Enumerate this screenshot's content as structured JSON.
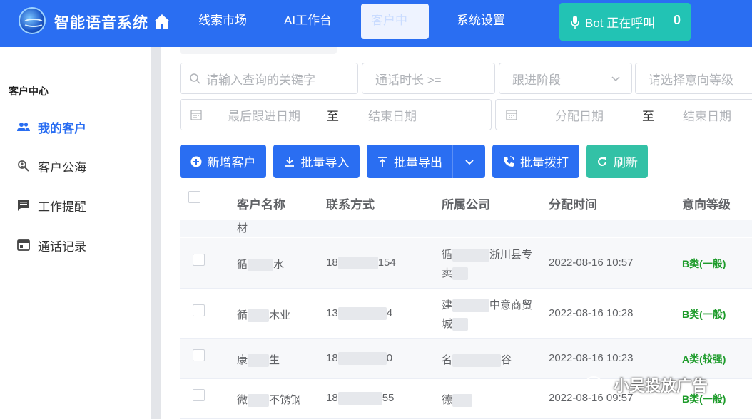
{
  "header": {
    "app_title": "智能语音系统",
    "nav": [
      "线索市场",
      "AI工作台",
      "客户中心",
      "系统设置"
    ],
    "active_nav": "客户中心",
    "bot_label": "Bot 正在呼叫",
    "bot_count": "0"
  },
  "sidebar": {
    "section": "客户中心",
    "items": [
      "我的客户",
      "客户公海",
      "工作提醒",
      "通话记录"
    ],
    "active": "我的客户"
  },
  "filters": {
    "keyword_placeholder": "请输入查询的关键字",
    "duration_placeholder": "通话时长 >=",
    "stage_placeholder": "跟进阶段",
    "intent_placeholder": "请选择意向等级",
    "last_follow_placeholder": "最后跟进日期",
    "to_label": "至",
    "end_date_placeholder": "结束日期",
    "assign_date_placeholder": "分配日期",
    "to_label_2": "至",
    "end_date_placeholder_2": "结束日期"
  },
  "toolbar": {
    "add_label": "新增客户",
    "import_label": "批量导入",
    "export_label": "批量导出",
    "dial_label": "批量拨打",
    "refresh_label": "刷新"
  },
  "table": {
    "headers": [
      "客户名称",
      "联系方式",
      "所属公司",
      "分配时间",
      "意向等级"
    ],
    "partial_top": "材",
    "rows": [
      {
        "name_a": "循",
        "name_b": "水",
        "phone_a": "18",
        "phone_b": "154",
        "company_l1a": "循",
        "company_l1b": "浙川县专",
        "company_l2": "卖",
        "time": "2022-08-16 10:57",
        "level": "B类(一般)"
      },
      {
        "name_a": "循",
        "name_b": "木业",
        "phone_a": "13",
        "phone_b": "4",
        "company_l1a": "建",
        "company_l1b": "中意商贸",
        "company_l2": "城",
        "time": "2022-08-16 10:28",
        "level": "B类(一般)"
      },
      {
        "name_a": "康",
        "name_b": "生",
        "phone_a": "18",
        "phone_b": "0",
        "company_l1a": "名",
        "company_l1b": "谷",
        "company_l2": "",
        "time": "2022-08-16 10:23",
        "level": "A类(较强)"
      },
      {
        "name_a": "微",
        "name_b": "不锈钢",
        "phone_a": "18",
        "phone_b": "55",
        "company_l1a": "德",
        "company_l1b": "",
        "company_l2": "",
        "time": "2022-08-16 09:57",
        "level": "B类(一般)"
      }
    ]
  },
  "watermark": "小吴投放广告",
  "colors": {
    "primary": "#2a6ef2",
    "teal": "#22c3b4",
    "green_btn": "#33c1a6",
    "level_text": "#1d9b2a"
  }
}
